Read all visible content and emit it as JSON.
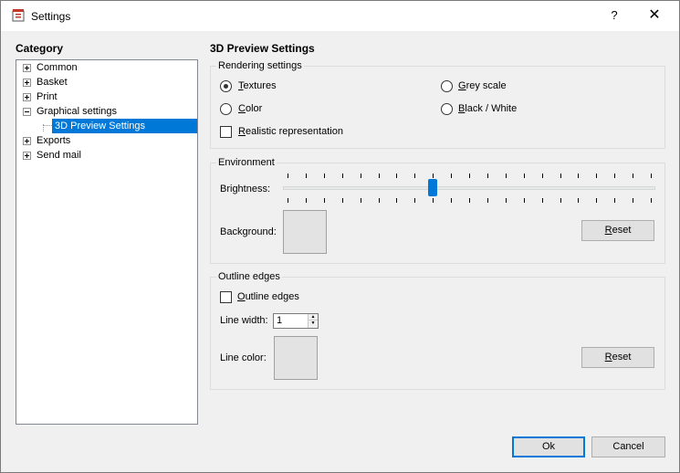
{
  "window": {
    "title": "Settings",
    "help_label": "?",
    "close_label": "✕"
  },
  "category": {
    "heading": "Category",
    "items": [
      {
        "label": "Common"
      },
      {
        "label": "Basket"
      },
      {
        "label": "Print"
      },
      {
        "label": "Graphical settings"
      },
      {
        "label": "3D Preview Settings",
        "selected": true
      },
      {
        "label": "Exports"
      },
      {
        "label": "Send mail"
      }
    ]
  },
  "page": {
    "title": "3D Preview Settings"
  },
  "rendering": {
    "title": "Rendering settings",
    "textures": "Textures",
    "grey_scale": "Grey scale",
    "color": "Color",
    "black_white": "Black / White",
    "realistic": "Realistic representation",
    "selected": "Textures"
  },
  "environment": {
    "title": "Environment",
    "brightness_label": "Brightness:",
    "brightness_level": 0.4,
    "background_label": "Background:",
    "reset_label": "Reset"
  },
  "outline": {
    "title": "Outline edges",
    "outline_checkbox": "Outline edges",
    "line_width_label": "Line width:",
    "line_width_value": "1",
    "line_color_label": "Line color:",
    "reset_label": "Reset"
  },
  "footer": {
    "ok_label": "Ok",
    "cancel_label": "Cancel"
  },
  "colors": {
    "accent": "#0078d7",
    "swatch": "#e3e3e3"
  }
}
